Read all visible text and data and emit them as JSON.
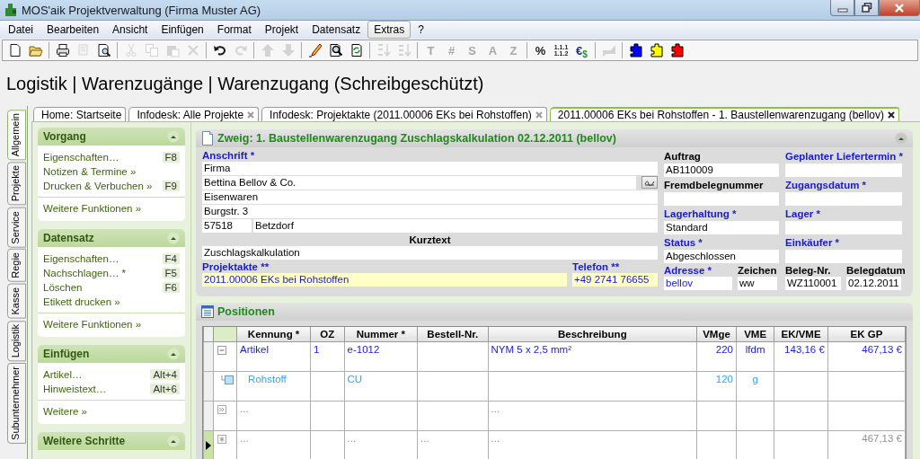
{
  "window": {
    "title": "MOS'aik Projektverwaltung (Firma Muster AG)"
  },
  "menu": [
    {
      "label": "Datei",
      "selected": false
    },
    {
      "label": "Bearbeiten",
      "selected": false
    },
    {
      "label": "Ansicht",
      "selected": false
    },
    {
      "label": "Einfügen",
      "selected": false
    },
    {
      "label": "Format",
      "selected": false
    },
    {
      "label": "Projekt",
      "selected": false
    },
    {
      "label": "Datensatz",
      "selected": false
    },
    {
      "label": "Extras",
      "selected": true
    },
    {
      "label": "?",
      "selected": false
    }
  ],
  "toolbar": [
    {
      "kind": "new",
      "disabled": false
    },
    {
      "kind": "open",
      "disabled": false
    },
    {
      "kind": "separator"
    },
    {
      "kind": "print",
      "disabled": false
    },
    {
      "kind": "print-setup",
      "disabled": true
    },
    {
      "kind": "preview",
      "disabled": false
    },
    {
      "kind": "separator"
    },
    {
      "kind": "cut",
      "disabled": true
    },
    {
      "kind": "copy",
      "disabled": true
    },
    {
      "kind": "paste",
      "disabled": true
    },
    {
      "kind": "delete",
      "disabled": true
    },
    {
      "kind": "separator"
    },
    {
      "kind": "undo",
      "disabled": false
    },
    {
      "kind": "redo",
      "disabled": true
    },
    {
      "kind": "separator"
    },
    {
      "kind": "up",
      "disabled": true
    },
    {
      "kind": "down",
      "disabled": true
    },
    {
      "kind": "separator"
    },
    {
      "kind": "edit",
      "disabled": false
    },
    {
      "kind": "find",
      "disabled": false
    },
    {
      "kind": "refresh",
      "disabled": false
    },
    {
      "kind": "separator"
    },
    {
      "kind": "sort-up",
      "disabled": true
    },
    {
      "kind": "sort-down",
      "disabled": true
    },
    {
      "kind": "separator"
    },
    {
      "kind": "glyph",
      "text": "T",
      "disabled": true
    },
    {
      "kind": "glyph",
      "text": "#",
      "disabled": true
    },
    {
      "kind": "glyph",
      "text": "S",
      "disabled": true
    },
    {
      "kind": "glyph",
      "text": "A",
      "disabled": true
    },
    {
      "kind": "glyph",
      "text": "Z",
      "disabled": true
    },
    {
      "kind": "separator"
    },
    {
      "kind": "glyph",
      "text": "%",
      "disabled": false
    },
    {
      "kind": "stack",
      "lines": [
        "1.1.1",
        "1.1.2"
      ],
      "disabled": false
    },
    {
      "kind": "pair",
      "texts": [
        "€",
        "$"
      ],
      "disabled": false
    },
    {
      "kind": "separator"
    },
    {
      "kind": "tool",
      "disabled": true
    },
    {
      "kind": "separator"
    },
    {
      "kind": "puzzle",
      "color": "#0000ff",
      "disabled": false
    },
    {
      "kind": "puzzle",
      "color": "#ffff00",
      "disabled": false
    },
    {
      "kind": "puzzle",
      "color": "#ff0000",
      "disabled": false
    }
  ],
  "breadcrumb": "Logistik | Warenzugänge | Warenzugang (Schreibgeschützt)",
  "side_tabs": [
    {
      "label": "Allgemein",
      "selected": true
    },
    {
      "label": "Projekte",
      "selected": false
    },
    {
      "label": "Service",
      "selected": false
    },
    {
      "label": "Regie",
      "selected": false
    },
    {
      "label": "Kasse",
      "selected": false
    },
    {
      "label": "Logistik",
      "selected": false
    },
    {
      "label": "Subunternehmer",
      "selected": false
    }
  ],
  "doc_tabs": [
    {
      "label": "Home: Startseite",
      "closable": false,
      "selected": false
    },
    {
      "label": "Infodesk: Alle Projekte",
      "closable": true,
      "selected": false
    },
    {
      "label": "Infodesk: Projektakte (2011.00006 EKs bei Rohstoffen)",
      "closable": true,
      "selected": false
    },
    {
      "label": "2011.00006 EKs bei Rohstoffen - 1. Baustellenwarenzugang (bellov)",
      "closable": true,
      "selected": true
    }
  ],
  "task_panels": [
    {
      "title": "Vorgang",
      "expanded": true,
      "items": [
        {
          "label": "Eigenschaften…",
          "shortcut": "F8"
        },
        {
          "label": "Notizen & Termine »"
        },
        {
          "label": "Drucken & Verbuchen »",
          "shortcut": "F9"
        }
      ],
      "more": "Weitere Funktionen »"
    },
    {
      "title": "Datensatz",
      "expanded": true,
      "items": [
        {
          "label": "Eigenschaften…",
          "shortcut": "F4"
        },
        {
          "label": "Nachschlagen… *",
          "shortcut": "F5"
        },
        {
          "label": "Löschen",
          "shortcut": "F6"
        },
        {
          "label": "Etikett drucken »"
        }
      ],
      "more": "Weitere Funktionen »"
    },
    {
      "title": "Einfügen",
      "expanded": true,
      "items": [
        {
          "label": "Artikel…",
          "shortcut": "Alt+4"
        },
        {
          "label": "Hinweistext…",
          "shortcut": "Alt+6"
        }
      ],
      "more": "Weitere »"
    },
    {
      "title": "Weitere Schritte",
      "expanded": true
    }
  ],
  "form": {
    "title": "Zweig: 1. Baustellenwarenzugang Zuschlagskalkulation 02.12.2011 (bellov)",
    "expanded": true,
    "address": {
      "label": "Anschrift *",
      "required": true,
      "lines": [
        "Firma",
        "Bettina Bellov & Co.",
        "Eisenwaren",
        "Burgstr. 3"
      ],
      "zip": "57518",
      "city": "Betzdorf"
    },
    "short_text": {
      "label": "Kurztext",
      "value": "Zuschlagskalkulation"
    },
    "project": {
      "label": "Projektakte **",
      "required": true,
      "value": "2011.00006 EKs bei Rohstoffen",
      "highlighted": true
    },
    "phone": {
      "label": "Telefon **",
      "required": true,
      "value": "+49 2741 76655",
      "highlighted": true
    },
    "middle": [
      {
        "label": "Auftrag",
        "required": false,
        "value": "AB110009"
      },
      {
        "label": "Fremdbelegnummer",
        "required": false
      },
      {
        "label": "Lagerhaltung *",
        "required": true,
        "value": "Standard"
      },
      {
        "label": "Status *",
        "required": true,
        "value": "Abgeschlossen"
      }
    ],
    "right": [
      {
        "label": "Geplanter Liefertermin *",
        "required": true
      },
      {
        "label": "Zugangsdatum *",
        "required": true
      },
      {
        "label": "Lager *",
        "required": true
      },
      {
        "label": "Einkäufer *",
        "required": true
      }
    ],
    "bottom": [
      {
        "label": "Adresse *",
        "required": true,
        "value": "bellov",
        "linked": true
      },
      {
        "label": "Zeichen",
        "required": false,
        "value": "ww",
        "linked": false
      },
      {
        "label": "Beleg-Nr.",
        "required": false,
        "value": "WZ110001",
        "linked": false
      },
      {
        "label": "Belegdatum",
        "required": false,
        "value": "02.12.2011",
        "linked": false
      }
    ]
  },
  "positions": {
    "title": "Positionen",
    "columns": [
      "Kennung *",
      "OZ",
      "Nummer *",
      "Bestell-Nr.",
      "Beschreibung",
      "VMge",
      "VME",
      "EK/VME",
      "EK GP"
    ],
    "rows": [
      {
        "kind": "item",
        "current": false,
        "cells": [
          "Artikel",
          "1",
          "e-1012",
          null,
          "NYM 5 x 2,5 mm²",
          "220",
          "lfdm",
          "143,16 €",
          "467,13 €"
        ]
      },
      {
        "kind": "child",
        "current": false,
        "cells": [
          "Rohstoff",
          null,
          "CU",
          null,
          null,
          "120",
          "g",
          null,
          null
        ]
      },
      {
        "kind": "placeholder",
        "current": false,
        "cells": [
          "...",
          null,
          null,
          null,
          "...",
          null,
          null,
          null,
          null
        ]
      },
      {
        "kind": "new",
        "current": true,
        "cells": [
          "...",
          null,
          "...",
          "...",
          "...",
          null,
          null,
          null,
          "467,13 €"
        ]
      }
    ]
  }
}
